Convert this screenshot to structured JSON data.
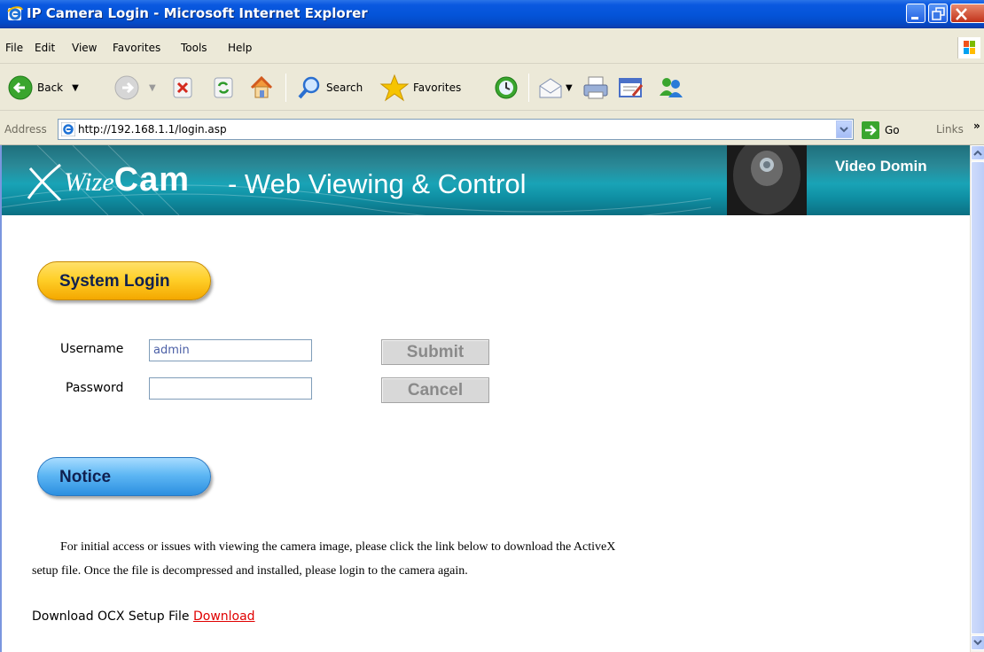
{
  "window": {
    "title": "IP Camera Login - Microsoft Internet Explorer"
  },
  "menu": [
    "File",
    "Edit",
    "View",
    "Favorites",
    "Tools",
    "Help"
  ],
  "toolbar": {
    "back_label": "Back",
    "search_label": "Search",
    "favorites_label": "Favorites"
  },
  "address": {
    "label": "Address",
    "url": "http://192.168.1.1/login.asp",
    "go_label": "Go",
    "links_label": "Links"
  },
  "banner": {
    "brand_prefix": "Wize",
    "brand_main": "Cam",
    "title": "- Web Viewing & Control",
    "right_text": "Video Domin"
  },
  "login": {
    "heading": "System Login",
    "username_label": "Username",
    "username_value": "admin",
    "password_label": "Password",
    "password_value": "",
    "submit_label": "Submit",
    "cancel_label": "Cancel"
  },
  "notice": {
    "heading": "Notice",
    "line1": "For initial access or issues with viewing the camera image, please click the link below to download the ActiveX",
    "line2": "setup file. Once the file is decompressed and installed, please login to the camera again.",
    "download_prefix": "Download OCX Setup File",
    "download_link": "Download"
  },
  "colors": {
    "xp_title_blue": "#0454d8",
    "banner_teal": "#19a3b6",
    "login_pill_yellow": "#ffd02a",
    "notice_pill_blue": "#5eb7f4",
    "link_red": "#e00000"
  },
  "icons": [
    "ie-icon",
    "minimize-icon",
    "maximize-icon",
    "close-icon",
    "windows-logo-icon",
    "back-icon",
    "forward-icon",
    "stop-icon",
    "refresh-icon",
    "home-icon",
    "search-icon",
    "favorites-star-icon",
    "history-icon",
    "mail-icon",
    "print-icon",
    "edit-icon",
    "messenger-icon",
    "go-arrow-icon"
  ]
}
